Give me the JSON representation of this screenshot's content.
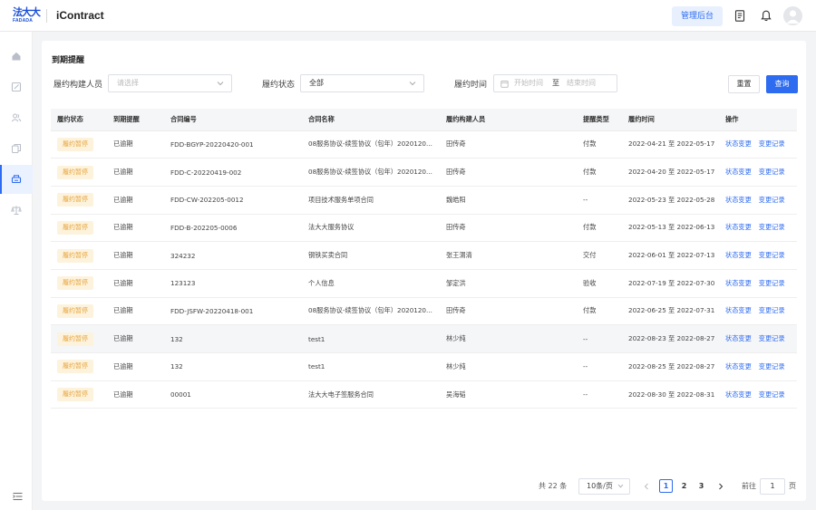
{
  "header": {
    "logo_text": "法大大",
    "logo_sub": "FADADA",
    "app_name": "iContract",
    "admin_label": "管理后台",
    "icons": [
      "document-icon",
      "bell-icon",
      "user-avatar-icon"
    ]
  },
  "sidebar": {
    "items": [
      {
        "icon": "home-icon",
        "active": false
      },
      {
        "icon": "edit-icon",
        "active": false
      },
      {
        "icon": "users-icon",
        "active": false
      },
      {
        "icon": "copy-icon",
        "active": false
      },
      {
        "icon": "print-icon",
        "active": true
      },
      {
        "icon": "scale-icon",
        "active": false
      }
    ],
    "collapse_icon": "menu-collapse-icon"
  },
  "page": {
    "title": "到期提醒"
  },
  "filters": {
    "builder_label": "履约构建人员",
    "builder_placeholder": "请选择",
    "status_label": "履约状态",
    "status_value": "全部",
    "time_label": "履约时间",
    "start_placeholder": "开始时间",
    "range_sep": "至",
    "end_placeholder": "结束时间",
    "reset_label": "重置",
    "query_label": "查询"
  },
  "table": {
    "columns": [
      "履约状态",
      "到期提醒",
      "合同编号",
      "合同名称",
      "履约构建人员",
      "提醒类型",
      "履约时间",
      "操作"
    ],
    "rows": [
      {
        "status": "履约暂停",
        "reminder": "已逾期",
        "code": "FDD-BGYP-20220420-001",
        "name": "08服务协议-续签协议（包年）2020120...",
        "person": "田传奇",
        "type": "付款",
        "time": "2022-04-21 至 2022-05-17",
        "highlight": false
      },
      {
        "status": "履约暂停",
        "reminder": "已逾期",
        "code": "FDD-C-20220419-002",
        "name": "08服务协议-续签协议（包年）2020120...",
        "person": "田传奇",
        "type": "付款",
        "time": "2022-04-20 至 2022-05-17",
        "highlight": false
      },
      {
        "status": "履约暂停",
        "reminder": "已逾期",
        "code": "FDD-CW-202205-0012",
        "name": "项目技术服务单项合同",
        "person": "魏皓阳",
        "type": "--",
        "time": "2022-05-23 至 2022-05-28",
        "highlight": false
      },
      {
        "status": "履约暂停",
        "reminder": "已逾期",
        "code": "FDD-B-202205-0006",
        "name": "法大大服务协议",
        "person": "田传奇",
        "type": "付款",
        "time": "2022-05-13 至 2022-06-13",
        "highlight": false
      },
      {
        "status": "履约暂停",
        "reminder": "已逾期",
        "code": "324232",
        "name": "钢铁买卖合同",
        "person": "张王渭清",
        "type": "交付",
        "time": "2022-06-01 至 2022-07-13",
        "highlight": false
      },
      {
        "status": "履约暂停",
        "reminder": "已逾期",
        "code": "123123",
        "name": "个人信息",
        "person": "邹定洪",
        "type": "验收",
        "time": "2022-07-19 至 2022-07-30",
        "highlight": false
      },
      {
        "status": "履约暂停",
        "reminder": "已逾期",
        "code": "FDD-JSFW-20220418-001",
        "name": "08服务协议-续签协议（包年）2020120...",
        "person": "田传奇",
        "type": "付款",
        "time": "2022-06-25 至 2022-07-31",
        "highlight": false
      },
      {
        "status": "履约暂停",
        "reminder": "已逾期",
        "code": "132",
        "name": "test1",
        "person": "林少纯",
        "type": "--",
        "time": "2022-08-23 至 2022-08-27",
        "highlight": true
      },
      {
        "status": "履约暂停",
        "reminder": "已逾期",
        "code": "132",
        "name": "test1",
        "person": "林少纯",
        "type": "--",
        "time": "2022-08-25 至 2022-08-27",
        "highlight": false
      },
      {
        "status": "履约暂停",
        "reminder": "已逾期",
        "code": "00001",
        "name": "法大大电子签服务合同",
        "person": "吴海韬",
        "type": "--",
        "time": "2022-08-30 至 2022-08-31",
        "highlight": false
      }
    ],
    "action_change_status": "状态变更",
    "action_change_log": "变更记录"
  },
  "pagination": {
    "total": "共 22 条",
    "page_size": "10条/页",
    "pages": [
      "1",
      "2",
      "3"
    ],
    "current": "1",
    "goto_label": "前往",
    "goto_value": "1",
    "page_unit": "页"
  },
  "colors": {
    "primary": "#2d6bf0",
    "tag_bg": "#fdf3dc",
    "tag_text": "#e6a23c"
  }
}
